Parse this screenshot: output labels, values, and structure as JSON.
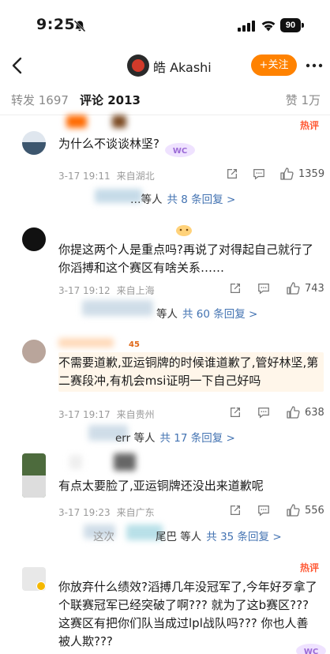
{
  "status": {
    "time": "9:25",
    "battery": "90"
  },
  "nav": {
    "title": "皓 Akashi",
    "follow_label": "+关注"
  },
  "tabs": {
    "repost": "转发 1697",
    "comment": "评论 2013",
    "like": "赞 1万"
  },
  "comments": [
    {
      "text": "为什么不谈谈林坚?",
      "date": "3-17 19:11",
      "location": "来自湖北",
      "likes": "1359",
      "reply_who": "…等人",
      "reply_more": "共 8 条回复 >",
      "hot": "热评"
    },
    {
      "text": "你提这两个人是重点吗?再说了对得起自己就行了 你滔搏和这个赛区有啥关系……",
      "date": "3-17 19:12",
      "location": "来自上海",
      "likes": "743",
      "reply_who": "等人",
      "reply_more": "共 60 条回复 >"
    },
    {
      "text": "不需要道歉,亚运铜牌的时候谁道歉了,管好林坚,第二赛段冲,有机会msi证明一下自己好吗",
      "date": "3-17 19:17",
      "location": "来自贵州",
      "likes": "638",
      "reply_who": "err 等人",
      "reply_more": "共 17 条回复 >"
    },
    {
      "text": "有点太要脸了,亚运铜牌还没出来道歉呢",
      "date": "3-17 19:23",
      "location": "来自广东",
      "likes": "556",
      "reply_who": "尾巴 等人",
      "reply_more": "共 35 条回复 >",
      "reply_prefix": "这次"
    },
    {
      "text": "你放弃什么绩效?滔搏几年没冠军了,今年好歹拿了个联赛冠军已经突破了啊??? 就为了这b赛区??? 这赛区有把你们队当成过lpl战队吗??? 你也人善被人欺???",
      "hot": "热评"
    }
  ],
  "colors": {
    "accent": "#ff8200",
    "link": "#4373b2",
    "hot": "#ff5a36"
  }
}
